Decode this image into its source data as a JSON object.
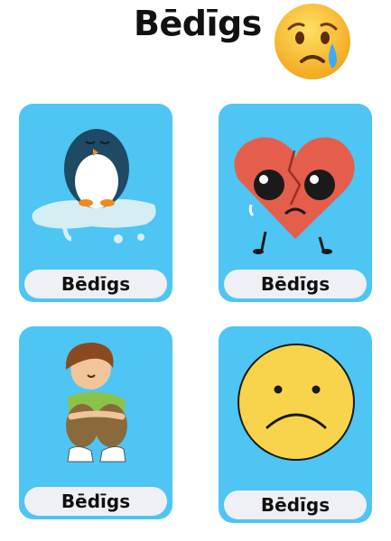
{
  "header": {
    "title": "Bēdīgs",
    "emoji_icon": "crying-face-icon"
  },
  "cards": [
    {
      "label": "Bēdīgs",
      "icon": "sad-penguin-on-ice-icon"
    },
    {
      "label": "Bēdīgs",
      "icon": "broken-heart-crying-icon"
    },
    {
      "label": "Bēdīgs",
      "icon": "sad-boy-sitting-icon"
    },
    {
      "label": "Bēdīgs",
      "icon": "frowning-face-icon"
    }
  ],
  "colors": {
    "card_background": "#4ec5f3",
    "label_background": "#eef0f5",
    "text": "#111111"
  }
}
